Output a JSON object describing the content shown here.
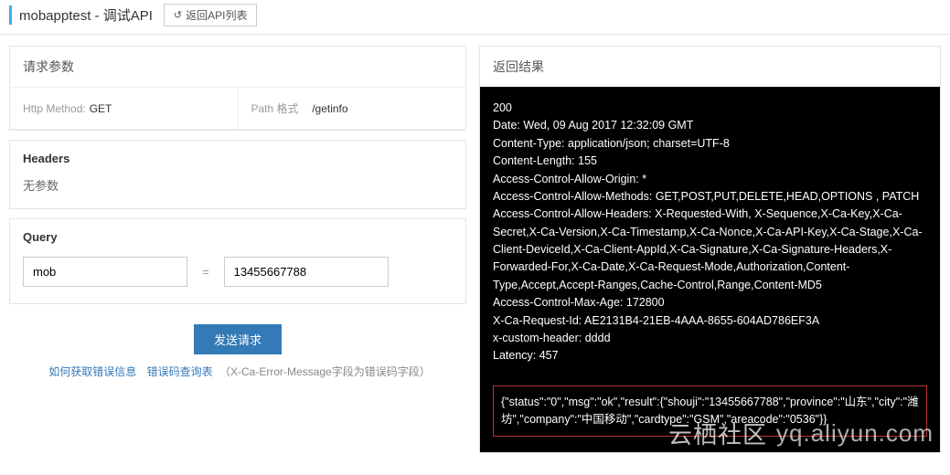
{
  "header": {
    "title": "mobapptest - 调试API",
    "back_label": "返回API列表"
  },
  "left": {
    "panel_title": "请求参数",
    "http_method_label": "Http Method:",
    "http_method_value": "GET",
    "path_label": "Path 格式",
    "path_value": "/getinfo",
    "headers_title": "Headers",
    "headers_empty": "无参数",
    "query_title": "Query",
    "query_key": "mob",
    "query_value": "13455667788",
    "send_label": "发送请求",
    "error_info_link": "如何获取错误信息",
    "error_table_link": "错误码查询表",
    "error_hint": "（X-Ca-Error-Message字段为错误码字段）"
  },
  "right": {
    "panel_title": "返回结果",
    "status_line": "200",
    "header_lines": [
      "Date: Wed, 09 Aug 2017 12:32:09 GMT",
      "Content-Type: application/json; charset=UTF-8",
      "Content-Length: 155",
      "Access-Control-Allow-Origin: *",
      "Access-Control-Allow-Methods: GET,POST,PUT,DELETE,HEAD,OPTIONS , PATCH",
      "Access-Control-Allow-Headers: X-Requested-With, X-Sequence,X-Ca-Key,X-Ca-Secret,X-Ca-Version,X-Ca-Timestamp,X-Ca-Nonce,X-Ca-API-Key,X-Ca-Stage,X-Ca-Client-DeviceId,X-Ca-Client-AppId,X-Ca-Signature,X-Ca-Signature-Headers,X-Forwarded-For,X-Ca-Date,X-Ca-Request-Mode,Authorization,Content-Type,Accept,Accept-Ranges,Cache-Control,Range,Content-MD5",
      "Access-Control-Max-Age: 172800",
      "X-Ca-Request-Id: AE2131B4-21EB-4AAA-8655-604AD786EF3A",
      "x-custom-header: dddd",
      "Latency: 457"
    ],
    "body_json": "{\"status\":\"0\",\"msg\":\"ok\",\"result\":{\"shouji\":\"13455667788\",\"province\":\"山东\",\"city\":\"潍坊\",\"company\":\"中国移动\",\"cardtype\":\"GSM\",\"areacode\":\"0536\"}}"
  },
  "watermark": {
    "cn": "云栖社区",
    "en": "yq.aliyun.com"
  }
}
